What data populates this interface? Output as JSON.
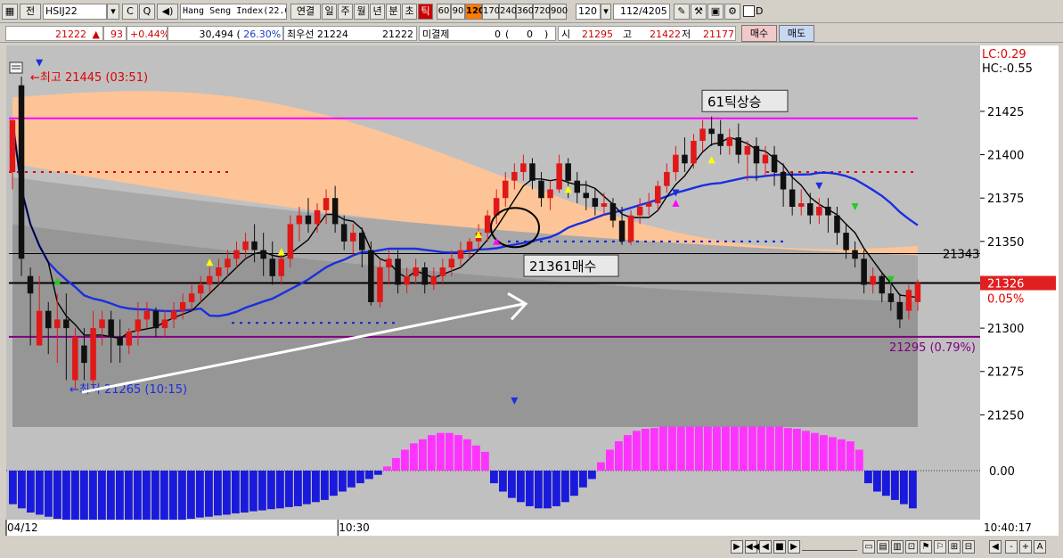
{
  "toolbar": {
    "mode": "전",
    "symbol": "HSIJ22",
    "product": "Hang Seng Index(22.0",
    "periods": [
      "연결",
      "일",
      "주",
      "월",
      "년",
      "분",
      "초",
      "틱"
    ],
    "tick_values": [
      "60",
      "90",
      "120",
      "170",
      "240",
      "360",
      "720",
      "900"
    ],
    "selected_tick": "120",
    "tick_input": "120",
    "count_current": "112",
    "count_total": "/4205",
    "checkbox_label": "D",
    "icons": [
      "chart-type-icon",
      "drawing-tool-icon",
      "speaker-icon",
      "tools-icon",
      "hammer-icon",
      "save-icon",
      "settings-icon"
    ]
  },
  "quote": {
    "price": "21222",
    "arrow": "▲",
    "change": "93",
    "change_pct": "+0.44%",
    "volume": "30,494",
    "volume_ratio_open": "(",
    "volume_ratio": "26.30%",
    "volume_ratio_close": ")",
    "best_priority_label": "최우선",
    "best_ask": "21224",
    "best_bid": "21222",
    "open_interest_label": "미결제",
    "open_interest": "0",
    "oi_change_open": "(",
    "oi_change": "0",
    "oi_change_close": ")",
    "open_label": "시",
    "open": "21295",
    "high_label": "고",
    "high": "21422",
    "low_label": "저",
    "low": "21177",
    "buy_label": "매수",
    "sell_label": "매도"
  },
  "chart_data": {
    "type": "candlestick",
    "y_axis_ticks": [
      21425,
      21400,
      21375,
      21350,
      21325,
      21300,
      21275,
      21250
    ],
    "ylim": [
      21243,
      21463
    ],
    "info": {
      "lc": "LC:0.29",
      "hc": "HC:-0.55"
    },
    "current_price": {
      "value": 21326,
      "label": "21326",
      "pct": "0.05%"
    },
    "hline_price": {
      "value": 21343,
      "label": "21343"
    },
    "reference_line": {
      "value": 21295,
      "label": "21295 (0.79%)"
    },
    "max_label": "←최고 21445 (03:51)",
    "min_label": "←최저 21265 (10:15)",
    "annotation_61": "61틱상승",
    "annotation_buy": "21361매수",
    "x_labels": [
      {
        "i": 0,
        "label": "04/12"
      },
      {
        "i": 37,
        "label": "10:30"
      }
    ],
    "time_readout": "10:40:17",
    "magenta_level": 21421,
    "dotted_red_levels": [
      21390
    ],
    "candles": [
      {
        "o": 21390,
        "h": 21400,
        "c": 21420,
        "l": 21380
      },
      {
        "o": 21440,
        "h": 21445,
        "c": 21340,
        "l": 21330
      },
      {
        "o": 21330,
        "h": 21335,
        "c": 21320,
        "l": 21290
      },
      {
        "o": 21290,
        "h": 21330,
        "c": 21310,
        "l": 21290
      },
      {
        "o": 21310,
        "h": 21315,
        "c": 21300,
        "l": 21285
      },
      {
        "o": 21300,
        "h": 21320,
        "c": 21305,
        "l": 21280
      },
      {
        "o": 21305,
        "h": 21320,
        "c": 21300,
        "l": 21270
      },
      {
        "o": 21270,
        "h": 21300,
        "c": 21295,
        "l": 21265
      },
      {
        "o": 21290,
        "h": 21300,
        "c": 21280,
        "l": 21270
      },
      {
        "o": 21270,
        "h": 21310,
        "c": 21300,
        "l": 21265
      },
      {
        "o": 21300,
        "h": 21310,
        "c": 21305,
        "l": 21290
      },
      {
        "o": 21305,
        "h": 21310,
        "c": 21295,
        "l": 21280
      },
      {
        "o": 21295,
        "h": 21305,
        "c": 21290,
        "l": 21280
      },
      {
        "o": 21290,
        "h": 21300,
        "c": 21298,
        "l": 21285
      },
      {
        "o": 21298,
        "h": 21315,
        "c": 21305,
        "l": 21290
      },
      {
        "o": 21305,
        "h": 21315,
        "c": 21310,
        "l": 21300
      },
      {
        "o": 21310,
        "h": 21312,
        "c": 21300,
        "l": 21295
      },
      {
        "o": 21300,
        "h": 21310,
        "c": 21305,
        "l": 21295
      },
      {
        "o": 21305,
        "h": 21315,
        "c": 21310,
        "l": 21300
      },
      {
        "o": 21310,
        "h": 21320,
        "c": 21315,
        "l": 21305
      },
      {
        "o": 21315,
        "h": 21325,
        "c": 21320,
        "l": 21310
      },
      {
        "o": 21320,
        "h": 21330,
        "c": 21325,
        "l": 21315
      },
      {
        "o": 21325,
        "h": 21335,
        "c": 21330,
        "l": 21320
      },
      {
        "o": 21330,
        "h": 21340,
        "c": 21335,
        "l": 21325
      },
      {
        "o": 21335,
        "h": 21345,
        "c": 21340,
        "l": 21330
      },
      {
        "o": 21340,
        "h": 21350,
        "c": 21345,
        "l": 21335
      },
      {
        "o": 21345,
        "h": 21355,
        "c": 21350,
        "l": 21340
      },
      {
        "o": 21350,
        "h": 21360,
        "c": 21345,
        "l": 21338
      },
      {
        "o": 21345,
        "h": 21355,
        "c": 21340,
        "l": 21330
      },
      {
        "o": 21340,
        "h": 21350,
        "c": 21330,
        "l": 21325
      },
      {
        "o": 21330,
        "h": 21345,
        "c": 21340,
        "l": 21325
      },
      {
        "o": 21340,
        "h": 21365,
        "c": 21360,
        "l": 21335
      },
      {
        "o": 21360,
        "h": 21370,
        "c": 21365,
        "l": 21350
      },
      {
        "o": 21365,
        "h": 21375,
        "c": 21360,
        "l": 21355
      },
      {
        "o": 21360,
        "h": 21372,
        "c": 21368,
        "l": 21355
      },
      {
        "o": 21368,
        "h": 21380,
        "c": 21375,
        "l": 21360
      },
      {
        "o": 21375,
        "h": 21382,
        "c": 21360,
        "l": 21355
      },
      {
        "o": 21360,
        "h": 21365,
        "c": 21350,
        "l": 21345
      },
      {
        "o": 21350,
        "h": 21360,
        "c": 21355,
        "l": 21342
      },
      {
        "o": 21355,
        "h": 21358,
        "c": 21345,
        "l": 21335
      },
      {
        "o": 21345,
        "h": 21350,
        "c": 21315,
        "l": 21313
      },
      {
        "o": 21315,
        "h": 21340,
        "c": 21335,
        "l": 21312
      },
      {
        "o": 21335,
        "h": 21345,
        "c": 21340,
        "l": 21325
      },
      {
        "o": 21340,
        "h": 21345,
        "c": 21325,
        "l": 21320
      },
      {
        "o": 21325,
        "h": 21335,
        "c": 21330,
        "l": 21320
      },
      {
        "o": 21330,
        "h": 21340,
        "c": 21335,
        "l": 21325
      },
      {
        "o": 21335,
        "h": 21338,
        "c": 21325,
        "l": 21320
      },
      {
        "o": 21325,
        "h": 21335,
        "c": 21330,
        "l": 21322
      },
      {
        "o": 21330,
        "h": 21340,
        "c": 21335,
        "l": 21325
      },
      {
        "o": 21335,
        "h": 21345,
        "c": 21340,
        "l": 21330
      },
      {
        "o": 21340,
        "h": 21350,
        "c": 21345,
        "l": 21335
      },
      {
        "o": 21345,
        "h": 21352,
        "c": 21350,
        "l": 21340
      },
      {
        "o": 21350,
        "h": 21360,
        "c": 21355,
        "l": 21345
      },
      {
        "o": 21355,
        "h": 21368,
        "c": 21365,
        "l": 21350
      },
      {
        "o": 21365,
        "h": 21380,
        "c": 21375,
        "l": 21360
      },
      {
        "o": 21375,
        "h": 21390,
        "c": 21385,
        "l": 21370
      },
      {
        "o": 21385,
        "h": 21395,
        "c": 21390,
        "l": 21380
      },
      {
        "o": 21390,
        "h": 21400,
        "c": 21395,
        "l": 21385
      },
      {
        "o": 21395,
        "h": 21398,
        "c": 21385,
        "l": 21380
      },
      {
        "o": 21385,
        "h": 21390,
        "c": 21375,
        "l": 21370
      },
      {
        "o": 21375,
        "h": 21385,
        "c": 21380,
        "l": 21368
      },
      {
        "o": 21380,
        "h": 21400,
        "c": 21395,
        "l": 21378
      },
      {
        "o": 21395,
        "h": 21398,
        "c": 21385,
        "l": 21375
      },
      {
        "o": 21385,
        "h": 21390,
        "c": 21378,
        "l": 21372
      },
      {
        "o": 21378,
        "h": 21385,
        "c": 21375,
        "l": 21368
      },
      {
        "o": 21375,
        "h": 21380,
        "c": 21370,
        "l": 21365
      },
      {
        "o": 21370,
        "h": 21378,
        "c": 21372,
        "l": 21365
      },
      {
        "o": 21372,
        "h": 21375,
        "c": 21362,
        "l": 21358
      },
      {
        "o": 21362,
        "h": 21370,
        "c": 21350,
        "l": 21348
      },
      {
        "o": 21350,
        "h": 21368,
        "c": 21365,
        "l": 21348
      },
      {
        "o": 21365,
        "h": 21375,
        "c": 21370,
        "l": 21360
      },
      {
        "o": 21370,
        "h": 21378,
        "c": 21372,
        "l": 21365
      },
      {
        "o": 21372,
        "h": 21385,
        "c": 21382,
        "l": 21368
      },
      {
        "o": 21382,
        "h": 21395,
        "c": 21390,
        "l": 21378
      },
      {
        "o": 21390,
        "h": 21405,
        "c": 21400,
        "l": 21385
      },
      {
        "o": 21400,
        "h": 21410,
        "c": 21395,
        "l": 21390
      },
      {
        "o": 21395,
        "h": 21412,
        "c": 21408,
        "l": 21392
      },
      {
        "o": 21408,
        "h": 21420,
        "c": 21415,
        "l": 21402
      },
      {
        "o": 21415,
        "h": 21422,
        "c": 21412,
        "l": 21405
      },
      {
        "o": 21412,
        "h": 21420,
        "c": 21405,
        "l": 21400
      },
      {
        "o": 21405,
        "h": 21415,
        "c": 21410,
        "l": 21400
      },
      {
        "o": 21410,
        "h": 21418,
        "c": 21400,
        "l": 21395
      },
      {
        "o": 21400,
        "h": 21408,
        "c": 21405,
        "l": 21385
      },
      {
        "o": 21405,
        "h": 21410,
        "c": 21395,
        "l": 21385
      },
      {
        "o": 21395,
        "h": 21405,
        "c": 21400,
        "l": 21388
      },
      {
        "o": 21400,
        "h": 21405,
        "c": 21390,
        "l": 21382
      },
      {
        "o": 21390,
        "h": 21395,
        "c": 21380,
        "l": 21370
      },
      {
        "o": 21380,
        "h": 21390,
        "c": 21370,
        "l": 21365
      },
      {
        "o": 21370,
        "h": 21380,
        "c": 21372,
        "l": 21365
      },
      {
        "o": 21372,
        "h": 21378,
        "c": 21365,
        "l": 21360
      },
      {
        "o": 21365,
        "h": 21375,
        "c": 21370,
        "l": 21360
      },
      {
        "o": 21370,
        "h": 21375,
        "c": 21365,
        "l": 21355
      },
      {
        "o": 21365,
        "h": 21370,
        "c": 21355,
        "l": 21348
      },
      {
        "o": 21355,
        "h": 21360,
        "c": 21345,
        "l": 21340
      },
      {
        "o": 21345,
        "h": 21350,
        "c": 21340,
        "l": 21335
      },
      {
        "o": 21340,
        "h": 21345,
        "c": 21325,
        "l": 21320
      },
      {
        "o": 21325,
        "h": 21335,
        "c": 21330,
        "l": 21320
      },
      {
        "o": 21330,
        "h": 21332,
        "c": 21320,
        "l": 21315
      },
      {
        "o": 21320,
        "h": 21325,
        "c": 21315,
        "l": 21310
      },
      {
        "o": 21315,
        "h": 21320,
        "c": 21305,
        "l": 21300
      },
      {
        "o": 21310,
        "h": 21325,
        "c": 21322,
        "l": 21305
      },
      {
        "o": 21315,
        "h": 21328,
        "c": 21326,
        "l": 21310
      }
    ],
    "oscillator": {
      "zero_label": "0.00",
      "values": [
        -0.8,
        -0.9,
        -1.0,
        -1.05,
        -1.1,
        -1.15,
        -1.2,
        -1.22,
        -1.25,
        -1.27,
        -1.28,
        -1.3,
        -1.3,
        -1.3,
        -1.28,
        -1.27,
        -1.25,
        -1.22,
        -1.2,
        -1.17,
        -1.15,
        -1.12,
        -1.1,
        -1.07,
        -1.05,
        -1.02,
        -1.0,
        -0.97,
        -0.95,
        -0.92,
        -0.9,
        -0.87,
        -0.85,
        -0.8,
        -0.75,
        -0.7,
        -0.6,
        -0.5,
        -0.4,
        -0.3,
        -0.2,
        -0.1,
        0.1,
        0.3,
        0.5,
        0.65,
        0.75,
        0.85,
        0.9,
        0.9,
        0.85,
        0.75,
        0.6,
        0.45,
        -0.3,
        -0.5,
        -0.65,
        -0.75,
        -0.85,
        -0.9,
        -0.9,
        -0.85,
        -0.75,
        -0.6,
        -0.4,
        -0.2,
        0.2,
        0.5,
        0.7,
        0.85,
        0.95,
        1.0,
        1.02,
        1.05,
        1.05,
        1.05,
        1.05,
        1.05,
        1.05,
        1.05,
        1.05,
        1.05,
        1.05,
        1.05,
        1.05,
        1.05,
        1.05,
        1.02,
        1.0,
        0.95,
        0.9,
        0.85,
        0.8,
        0.75,
        0.7,
        0.5,
        -0.3,
        -0.5,
        -0.6,
        -0.7,
        -0.8,
        -0.9
      ]
    }
  },
  "bottom": {
    "time": "10:40:17",
    "controls": [
      "▶",
      "|◀◀",
      "◀",
      "■",
      "▶",
      "▶▶|"
    ],
    "zoom": [
      "-",
      "+",
      "A"
    ]
  }
}
